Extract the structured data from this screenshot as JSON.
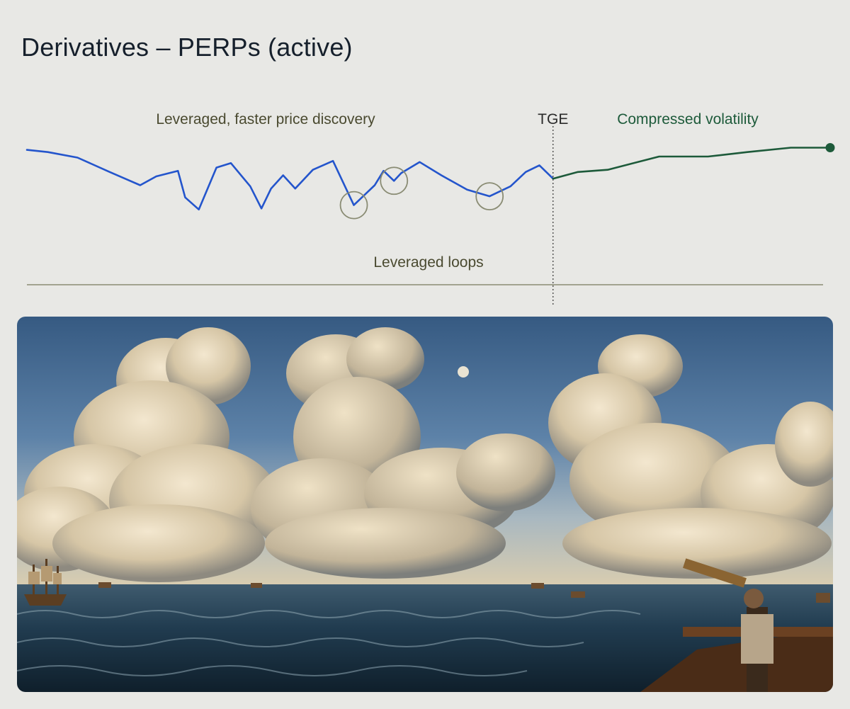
{
  "title": "Derivatives – PERPs (active)",
  "colors": {
    "background": "#e8e8e5",
    "pre_tge_line": "#2455cc",
    "post_tge_line": "#1d5a3a",
    "annotation_text": "#4a4a30",
    "baseline": "#8a8c74",
    "loop_circle": "#8a8c74",
    "divider": "#333333"
  },
  "chart_data": {
    "type": "line",
    "annotations": {
      "pre_tge": "Leveraged, faster price discovery",
      "tge": "TGE",
      "post_tge": "Compressed volatility",
      "loops": "Leveraged loops"
    },
    "x_range": [
      0,
      100
    ],
    "y_range": [
      0,
      100
    ],
    "tge_x": 65.5,
    "loop_points": [
      40.7,
      45.7,
      57.6
    ],
    "series": [
      {
        "values": [
          [
            0,
            90
          ],
          [
            2.6,
            88
          ],
          [
            6.3,
            83
          ],
          [
            10.3,
            70
          ],
          [
            14.1,
            58
          ],
          [
            16.1,
            66
          ],
          [
            18.8,
            71
          ],
          [
            19.7,
            47
          ],
          [
            21.4,
            36
          ],
          [
            23.6,
            74
          ],
          [
            25.4,
            78
          ],
          [
            27.8,
            57
          ],
          [
            29.2,
            37
          ],
          [
            30.4,
            55
          ],
          [
            31.9,
            67
          ],
          [
            33.4,
            55
          ],
          [
            35.6,
            72
          ],
          [
            38.1,
            80
          ],
          [
            40.7,
            40
          ],
          [
            43.3,
            58
          ],
          [
            44.4,
            71
          ],
          [
            45.7,
            62
          ],
          [
            46.6,
            69
          ],
          [
            48.9,
            79
          ],
          [
            51.6,
            67
          ],
          [
            54.8,
            54
          ],
          [
            57.6,
            48
          ],
          [
            60.2,
            57
          ],
          [
            62.1,
            70
          ],
          [
            63.8,
            76
          ],
          [
            65.5,
            64
          ]
        ]
      },
      {
        "values": [
          [
            65.5,
            64
          ],
          [
            68.6,
            70
          ],
          [
            72.3,
            72
          ],
          [
            78.7,
            84
          ],
          [
            84.8,
            84
          ],
          [
            89.7,
            88
          ],
          [
            95.1,
            92
          ],
          [
            100,
            92
          ]
        ]
      }
    ]
  },
  "painting": {
    "alt_name": "seascape-painting"
  }
}
